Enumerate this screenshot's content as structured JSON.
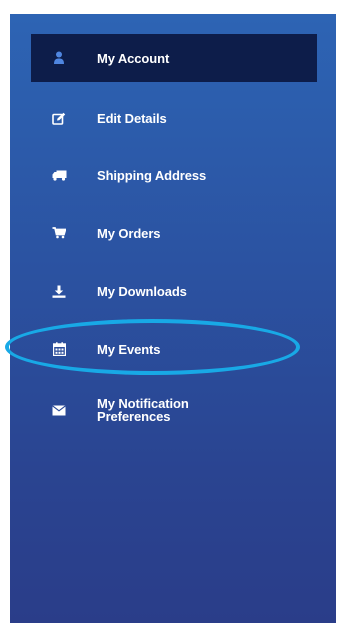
{
  "sidebar": {
    "items": [
      {
        "label": "My Account",
        "icon": "user-icon",
        "active": true
      },
      {
        "label": "Edit Details",
        "icon": "edit-icon",
        "active": false
      },
      {
        "label": "Shipping Address",
        "icon": "truck-icon",
        "active": false
      },
      {
        "label": "My Orders",
        "icon": "cart-icon",
        "active": false
      },
      {
        "label": "My Downloads",
        "icon": "download-icon",
        "active": false
      },
      {
        "label": "My Events",
        "icon": "calendar-icon",
        "active": false,
        "highlighted": true
      },
      {
        "label": "My Notification Preferences",
        "icon": "envelope-icon",
        "active": false
      }
    ]
  },
  "colors": {
    "active_item_background": "#0d1d4a",
    "active_icon": "#4f86e0",
    "highlight_ring": "#18a9e6",
    "text": "#ffffff"
  }
}
